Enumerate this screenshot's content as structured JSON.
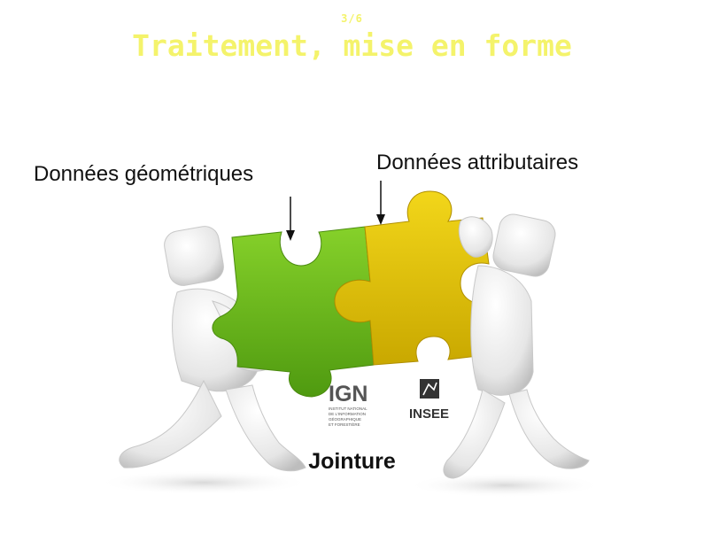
{
  "slide": {
    "counter": "3/6",
    "title": "Traitement, mise en forme",
    "title_color": "#f4f36b"
  },
  "labels": {
    "geometric": "Données géométriques",
    "attribute": "Données attributaires"
  },
  "caption": "Jointure",
  "logos": {
    "ign": {
      "name": "IGN",
      "line1": "INSTITUT NATIONAL",
      "line2": "DE L'INFORMATION",
      "line3": "GÉOGRAPHIQUE",
      "line4": "ET FORESTIÈRE",
      "color": "#555555"
    },
    "insee": {
      "name": "INSEE",
      "color": "#333333"
    }
  },
  "colors": {
    "puzzle_green": "#6dbb1e",
    "puzzle_yellow": "#e3c500",
    "figure_white": "#e8e8e8"
  }
}
